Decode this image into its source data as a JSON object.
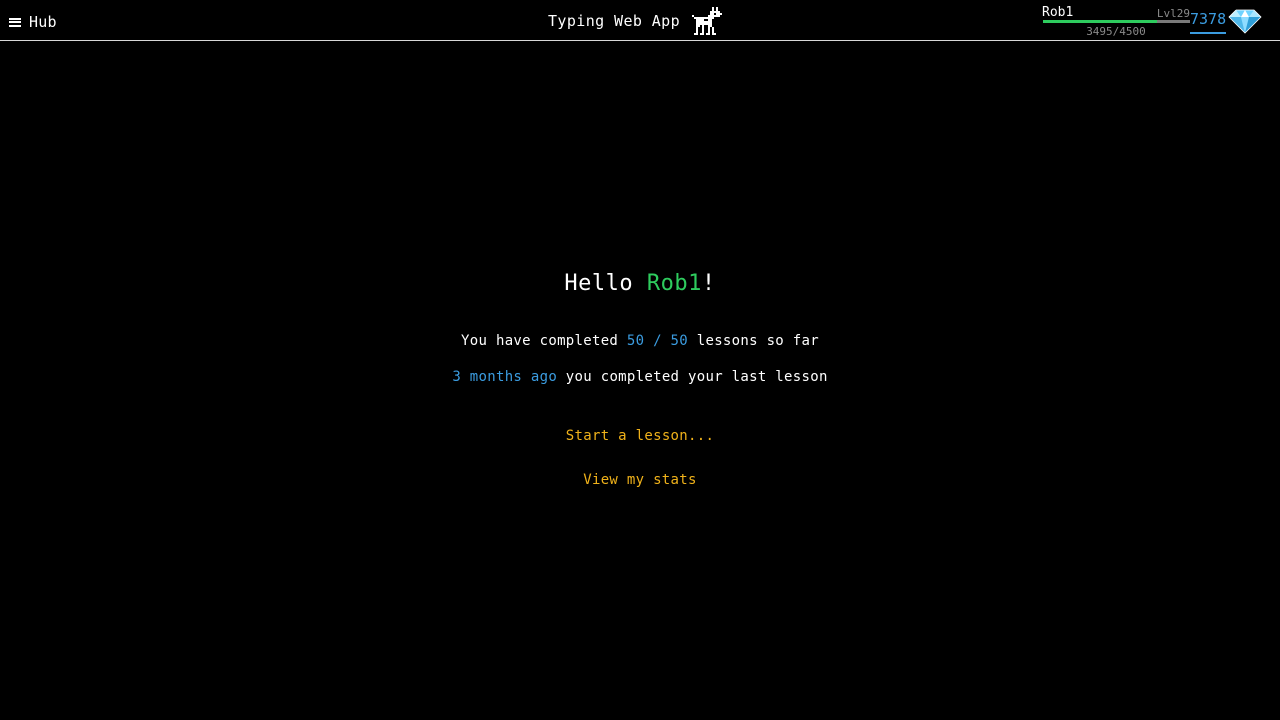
{
  "header": {
    "menu_label": "Hub",
    "app_title": "Typing Web App",
    "menu_icon": "hamburger-icon",
    "logo_icon": "dog-icon"
  },
  "user": {
    "name": "Rob1",
    "level": "Lvl29",
    "xp_text": "3495/4500",
    "xp_current": 3495,
    "xp_total": 4500,
    "gems": "7378",
    "gem_icon": "diamond-icon"
  },
  "greeting": {
    "prefix": "Hello ",
    "name": "Rob1",
    "suffix": "!"
  },
  "progress": {
    "prefix": "You have completed ",
    "count": "50 / 50",
    "suffix": " lessons so far"
  },
  "last_lesson": {
    "when": "3 months ago",
    "suffix": " you completed your last lesson"
  },
  "actions": {
    "start_lesson": "Start a lesson...",
    "view_stats": "View my stats"
  },
  "colors": {
    "accent_green": "#2ecc5e",
    "accent_blue": "#3b9ce0",
    "link_orange": "#f0b21a",
    "background": "#000000"
  }
}
